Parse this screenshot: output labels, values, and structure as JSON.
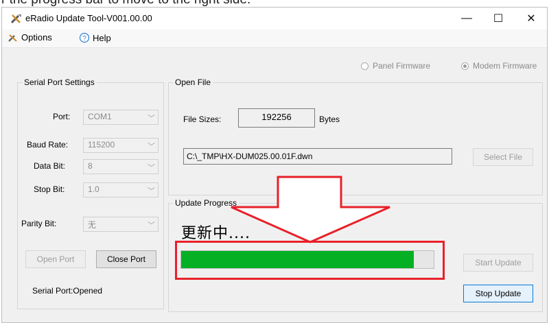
{
  "caption": "r the progress bar to move to the right side.",
  "window": {
    "title": "eRadio Update Tool-V001.00.00",
    "controls": {
      "minimize": "—",
      "maximize": "☐",
      "close": "✕"
    }
  },
  "menu": {
    "options": "Options",
    "help": "Help"
  },
  "firmware": {
    "panel": "Panel Firmware",
    "modem": "Modem Firmware",
    "selected": "modem"
  },
  "serial": {
    "legend": "Serial Port Settings",
    "port_label": "Port:",
    "port_value": "COM1",
    "baud_label": "Baud Rate:",
    "baud_value": "115200",
    "data_label": "Data Bit:",
    "data_value": "8",
    "stop_label": "Stop Bit:",
    "stop_value": "1.0",
    "parity_label": "Parity Bit:",
    "parity_value": "无",
    "open_button": "Open Port",
    "close_button": "Close Port",
    "status_label": "Serial Port:",
    "status_value": "Opened"
  },
  "open_file": {
    "legend": "Open File",
    "size_label": "File Sizes:",
    "size_value": "192256",
    "size_unit": "Bytes",
    "path": "C:\\_TMP\\HX-DUM025.00.01F.dwn",
    "select_button": "Select File"
  },
  "progress": {
    "legend": "Update Progress",
    "status": "更新中....",
    "fraction": 0.92,
    "start_button": "Start Update",
    "stop_button": "Stop Update"
  },
  "colors": {
    "progress": "#06b025",
    "annotation": "#e8202a",
    "accent": "#0078d7"
  }
}
